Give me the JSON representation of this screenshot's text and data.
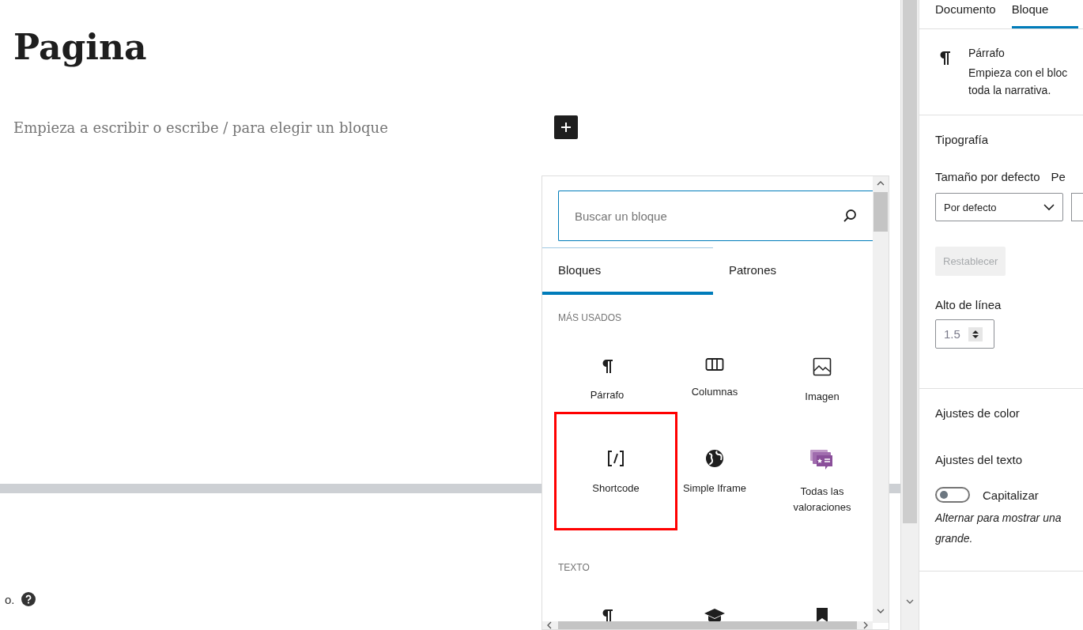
{
  "editor": {
    "title": "Pagina",
    "placeholder": "Empieza a escribir o escribe / para elegir un bloque",
    "footer_text": "o."
  },
  "inserter": {
    "search": {
      "placeholder": "Buscar un bloque"
    },
    "tabs": [
      {
        "label": "Bloques",
        "selected": true
      },
      {
        "label": "Patrones",
        "selected": false
      }
    ],
    "sections": [
      {
        "heading": "MÁS USADOS",
        "items": [
          {
            "label": "Párrafo",
            "highlighted": false
          },
          {
            "label": "Columnas",
            "highlighted": false
          },
          {
            "label": "Imagen",
            "highlighted": false
          },
          {
            "label": "Shortcode",
            "highlighted": true
          },
          {
            "label": "Simple Iframe",
            "highlighted": false
          },
          {
            "label": "Todas las valoraciones",
            "highlighted": false
          }
        ]
      },
      {
        "heading": "TEXTO",
        "items": [
          {
            "highlighted": false
          },
          {
            "highlighted": false
          },
          {
            "highlighted": false
          }
        ]
      }
    ]
  },
  "sidebar": {
    "tabs": [
      {
        "label": "Documento",
        "selected": false
      },
      {
        "label": "Bloque",
        "selected": true
      }
    ],
    "block": {
      "name": "Párrafo",
      "description_lines": [
        "Empieza con el bloc",
        "toda la narrativa."
      ]
    },
    "typography": {
      "heading": "Tipografía",
      "size_label": "Tamaño por defecto",
      "size_value": "Por defecto",
      "custom_label": "Pe",
      "reset_button": {
        "label": "Restablecer",
        "disabled": true
      },
      "line_height_label": "Alto de línea",
      "line_height_value": "1.5"
    },
    "color_heading": "Ajustes de color",
    "text_settings": {
      "heading": "Ajustes del texto",
      "toggle": {
        "label": "Capitalizar",
        "on": false
      },
      "help_lines": [
        "Alternar para mostrar una",
        "grande."
      ]
    }
  }
}
